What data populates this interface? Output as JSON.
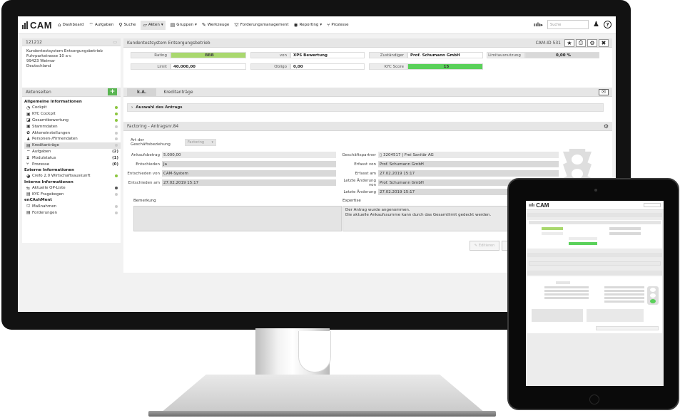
{
  "app": {
    "logo": "CAM"
  },
  "nav": {
    "items": [
      {
        "label": "Dashboard",
        "icon": "home-icon",
        "glyph": "⌂"
      },
      {
        "label": "Aufgaben",
        "icon": "inbox-icon",
        "glyph": "⌔"
      },
      {
        "label": "Suche",
        "icon": "search-icon",
        "glyph": "⚲"
      },
      {
        "label": "Akten",
        "icon": "folder-icon",
        "glyph": "▱",
        "caret": "▾"
      },
      {
        "label": "Gruppen",
        "icon": "group-icon",
        "glyph": "▤",
        "caret": "▾"
      },
      {
        "label": "Werkzeuge",
        "icon": "wrench-icon",
        "glyph": "✎"
      },
      {
        "label": "Forderungsmanagement",
        "icon": "bank-icon",
        "glyph": "⛫"
      },
      {
        "label": "Reporting",
        "icon": "camera-icon",
        "glyph": "◉",
        "caret": "▾"
      },
      {
        "label": "Prozesse",
        "icon": "process-icon",
        "glyph": "⑂"
      }
    ],
    "search_placeholder": "Suche"
  },
  "record": {
    "id": "121212",
    "name": "Kundentestsystem Entsorgungsbetrieb",
    "address": [
      "Kundentestsystem Entsorgungsbetrieb",
      "Fuhrparkstrasse 10 a-c",
      "99423 Weimar",
      "Deutschland"
    ],
    "cam_id": "CAM-ID 531",
    "rating_label": "Rating",
    "rating_value": "BBB",
    "von_label": "von",
    "von_value": "XPS Bewertung",
    "zustaendiger_label": "Zuständiger",
    "zustaendiger_value": "Prof. Schumann GmbH",
    "limitauslastung_label": "Limitausnutzung",
    "limitauslastung_value": "0,00 %",
    "limit_label": "Limit",
    "limit_value": "40.000,00",
    "obligo_label": "Obligo",
    "obligo_value": "0,00",
    "kyc_label": "KYC Score",
    "kyc_value": "15"
  },
  "sidebar": {
    "title": "Aktenseiten",
    "sections": [
      {
        "header": "Allgemeine Informationen",
        "items": [
          {
            "label": "Cockpit",
            "glyph": "◔",
            "status": "green"
          },
          {
            "label": "KYC Cockpit",
            "glyph": "▣",
            "status": "green"
          },
          {
            "label": "Gesamtbewertung",
            "glyph": "◪",
            "status": "green"
          },
          {
            "label": "Stammdaten",
            "glyph": "▣",
            "status": "gray"
          },
          {
            "label": "Akteneinstellungen",
            "glyph": "✿",
            "status": "gray"
          },
          {
            "label": "Personen-/Firmendaten",
            "glyph": "♟",
            "status": "gray"
          },
          {
            "label": "Kreditanträge",
            "glyph": "▤",
            "status": "gray",
            "active": true
          },
          {
            "label": "Aufgaben",
            "glyph": "⌔",
            "count": "(2)"
          },
          {
            "label": "Modulstatus",
            "glyph": "⧗",
            "count": "(1)"
          },
          {
            "label": "Prozesse",
            "glyph": "⑂",
            "count": "(0)"
          }
        ]
      },
      {
        "header": "Externe Informationen",
        "items": [
          {
            "label": "Crefo 2.0 Wirtschaftsauskunft",
            "glyph": "◕",
            "status": "green"
          }
        ]
      },
      {
        "header": "Interne Informationen",
        "items": [
          {
            "label": "Aktuelle OP-Liste",
            "glyph": "⇆",
            "status": "dark"
          },
          {
            "label": "KYC Fragebogen",
            "glyph": "▤",
            "status": "gray"
          }
        ]
      },
      {
        "header": "enCAshMent",
        "items": [
          {
            "label": "Maßnahmen",
            "glyph": "⛫",
            "status": "gray"
          },
          {
            "label": "Forderungen",
            "glyph": "▤",
            "status": "gray"
          }
        ]
      }
    ]
  },
  "tabs": {
    "ka": "k.A.",
    "kredit": "Kreditanträge"
  },
  "antrag": {
    "auswahl": "Auswahl des Antrags",
    "section_title": "Factoring - Antragsnr.84",
    "art_label": "Art der Geschäftsbeziehung",
    "art_value": "Factoring",
    "ankaufsbetrag_label": "Ankaufsbetrag",
    "ankaufsbetrag_value": "5.000,00",
    "entschieden_label": "Entschieden",
    "entschieden_value": "Ja",
    "entschieden_von_label": "Entschieden von",
    "entschieden_von_value": "CAM-System",
    "entschieden_am_label": "Entschieden am",
    "entschieden_am_value": "27.02.2019 15:17",
    "partner_label": "Geschäftspartner",
    "partner_value": "3204517 | Frei Sanitär AG",
    "erfasst_von_label": "Erfasst von",
    "erfasst_von_value": "Prof. Schumann GmbH",
    "erfasst_am_label": "Erfasst am",
    "erfasst_am_value": "27.02.2019 15:17",
    "letzte_aend_von_label": "Letzte Änderung von",
    "letzte_aend_von_value": "Prof. Schumann GmbH",
    "letzte_aend_label": "Letzte Änderung",
    "letzte_aend_value": "27.02.2019 15:17",
    "bemerkung_label": "Bemerkung",
    "expertise_label": "Expertise",
    "expertise_lines": [
      "Der Antrag wurde angenommen.",
      "Die aktuelle Ankaufssumme kann durch das Gesamtlimit gedeckt werden."
    ],
    "btn_edit": "Editieren"
  },
  "colors": {
    "green": "#8cc63f",
    "bright_green": "#5ad15a",
    "header": "#e6e6e6"
  }
}
